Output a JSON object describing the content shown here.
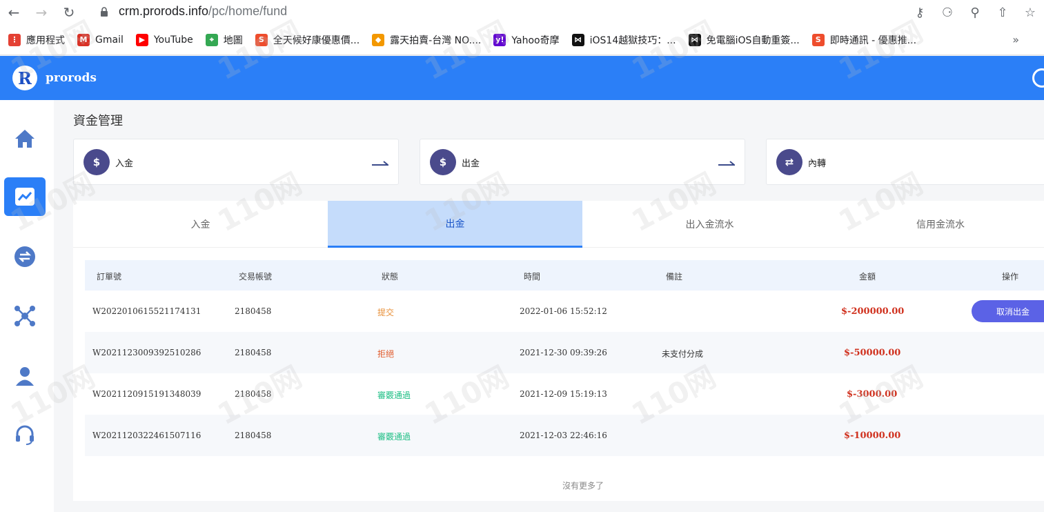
{
  "browser": {
    "url_domain": "crm.prorods.info",
    "url_path": "/pc/home/fund"
  },
  "bookmarks": [
    {
      "label": "應用程式",
      "icon": "apps-grid-icon",
      "color": "#e44134"
    },
    {
      "label": "Gmail",
      "icon": "gmail-icon",
      "color": "#d93025"
    },
    {
      "label": "YouTube",
      "icon": "youtube-icon",
      "color": "#ff0000"
    },
    {
      "label": "地圖",
      "icon": "maps-icon",
      "color": "#34a853"
    },
    {
      "label": "全天候好康優惠價...",
      "icon": "shopee-icon",
      "color": "#ee4d2d"
    },
    {
      "label": "露天拍賣-台灣 NO....",
      "icon": "ruten-icon",
      "color": "#f39800"
    },
    {
      "label": "Yahoo奇摩",
      "icon": "yahoo-icon",
      "color": "#6001d2"
    },
    {
      "label": "iOS14越獄技巧：...",
      "icon": "bookmark-icon",
      "color": "#111111"
    },
    {
      "label": "免電腦iOS自動重簽...",
      "icon": "bookmark-icon",
      "color": "#111111"
    },
    {
      "label": "即時通訊 - 優惠推...",
      "icon": "shopee-icon",
      "color": "#ee4d2d"
    }
  ],
  "app": {
    "brand": "prorods",
    "logo_letter": "R",
    "accent": "#2b7ff7"
  },
  "page": {
    "title": "資金管理"
  },
  "cards": [
    {
      "label": "入金",
      "icon": "money-bag-icon"
    },
    {
      "label": "出金",
      "icon": "money-bag-icon"
    },
    {
      "label": "內轉",
      "icon": "transfer-icon"
    }
  ],
  "tabs": [
    {
      "label": "入金",
      "active": false
    },
    {
      "label": "出金",
      "active": true
    },
    {
      "label": "出入金流水",
      "active": false
    },
    {
      "label": "信用金流水",
      "active": false
    }
  ],
  "table": {
    "headers": [
      "訂單號",
      "交易帳號",
      "狀態",
      "時間",
      "備註",
      "金額",
      "操作"
    ],
    "rows": [
      {
        "order": "W20220106155211 74131",
        "account": "2180458",
        "status": "提交",
        "time": "2022-01-06 15:52:12",
        "note": "",
        "amount": "$-200000.00",
        "action": "取消出金"
      },
      {
        "order": "W2021123009392510286",
        "account": "2180458",
        "status": "拒絕",
        "time": "2021-12-30 09:39:26",
        "note": "未支付分成",
        "amount": "$-50000.00",
        "action": ""
      },
      {
        "order": "W2021120915191348039",
        "account": "2180458",
        "status": "審覈通過",
        "time": "2021-12-09 15:19:13",
        "note": "",
        "amount": "$-3000.00",
        "action": ""
      },
      {
        "order": "W2021120322461507116",
        "account": "2180458",
        "status": "審覈通過",
        "time": "2021-12-03 22:46:16",
        "note": "",
        "amount": "$-10000.00",
        "action": ""
      }
    ],
    "footer": "沒有更多了"
  },
  "watermark": "110网"
}
